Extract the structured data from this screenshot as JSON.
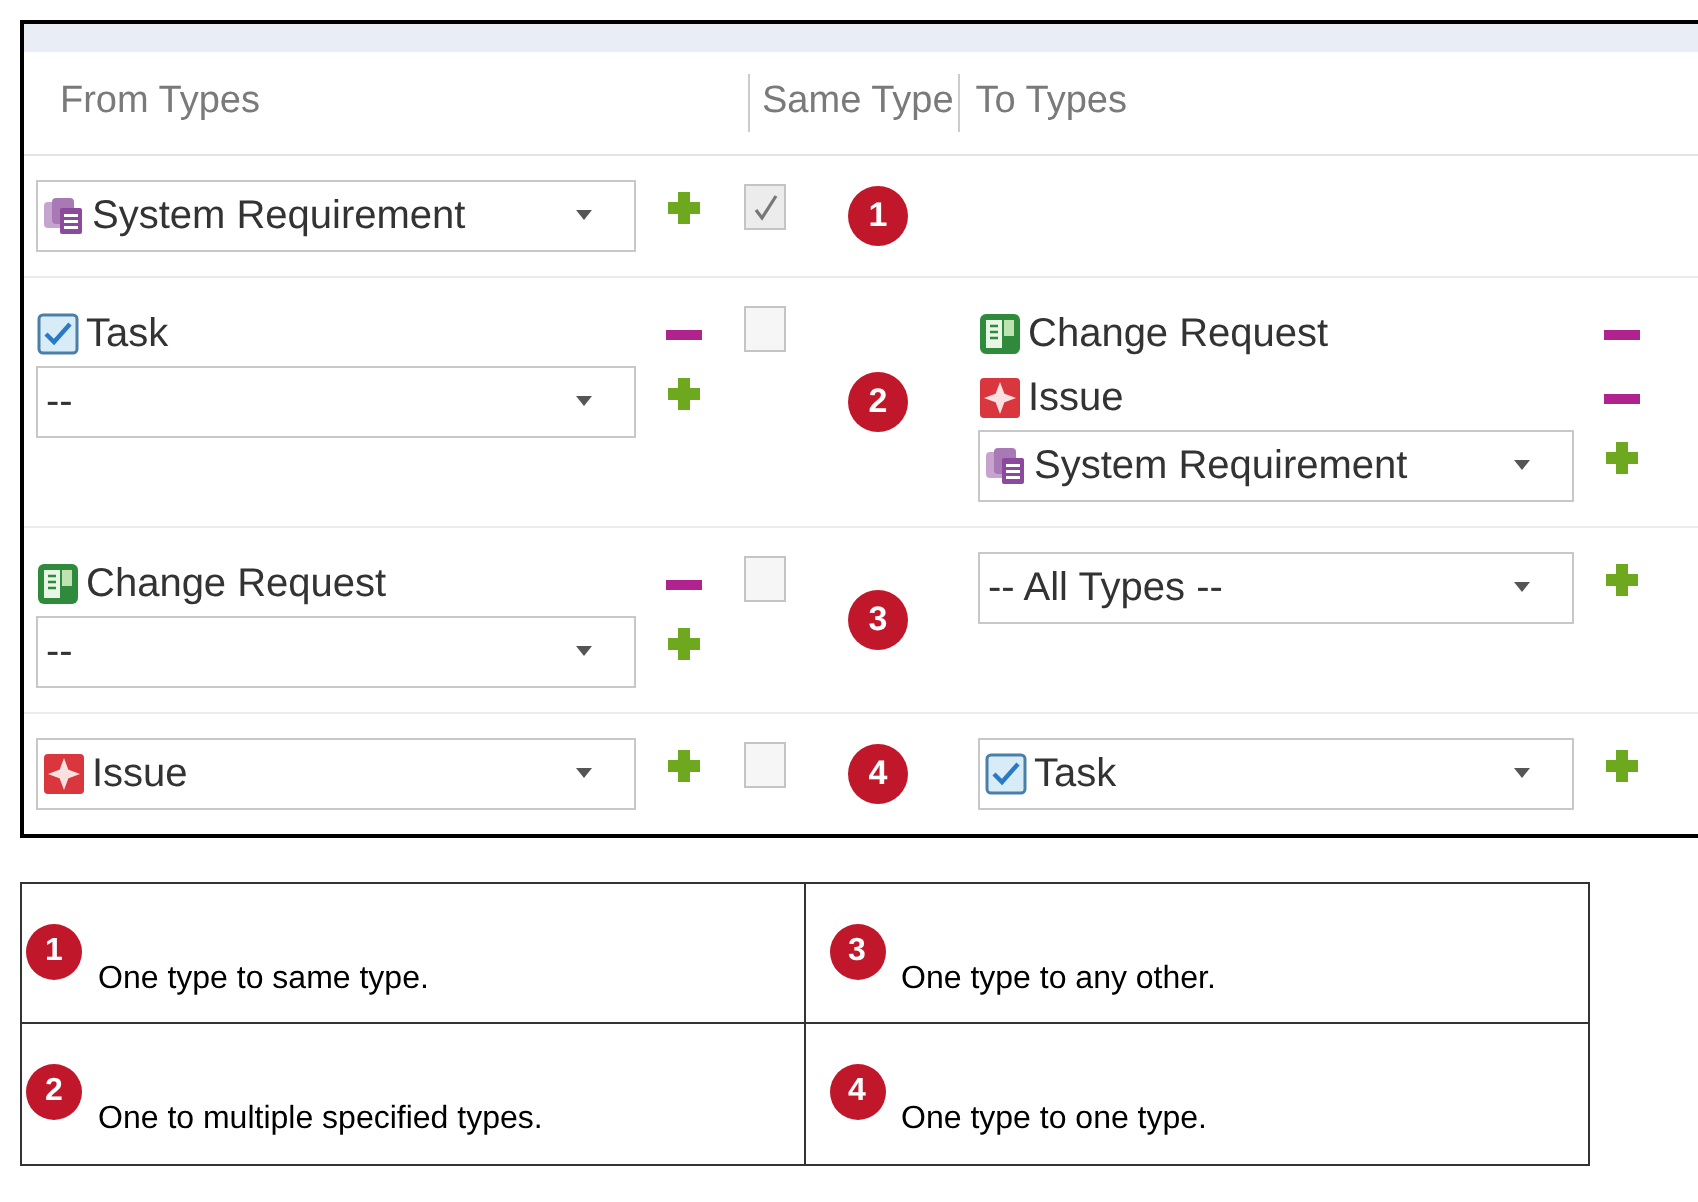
{
  "header": {
    "columns": [
      "From Types",
      "Same Type",
      "To Types"
    ]
  },
  "rows": [
    {
      "from_items": [],
      "from_select": {
        "value": "System Requirement",
        "kind": "requirement"
      },
      "same_type": true,
      "badge": "1",
      "to_items": [],
      "to_select": null
    },
    {
      "from_items": [
        {
          "label": "Task",
          "kind": "task"
        }
      ],
      "from_select": {
        "value": "--",
        "kind": "none"
      },
      "same_type": false,
      "badge": "2",
      "to_items": [
        {
          "label": "Change Request",
          "kind": "change"
        },
        {
          "label": "Issue",
          "kind": "issue"
        }
      ],
      "to_select": {
        "value": "System Requirement",
        "kind": "requirement"
      }
    },
    {
      "from_items": [
        {
          "label": "Change Request",
          "kind": "change"
        }
      ],
      "from_select": {
        "value": "--",
        "kind": "none"
      },
      "same_type": false,
      "badge": "3",
      "to_items": [],
      "to_select": {
        "value": "-- All Types --",
        "kind": "none"
      }
    },
    {
      "from_items": [],
      "from_select": {
        "value": "Issue",
        "kind": "issue"
      },
      "same_type": false,
      "badge": "4",
      "to_items": [],
      "to_select": {
        "value": "Task",
        "kind": "task"
      }
    }
  ],
  "legend": [
    {
      "badge": "1",
      "text": "One type to same type."
    },
    {
      "badge": "3",
      "text": "One type to any other."
    },
    {
      "badge": "2",
      "text": "One to multiple specified types."
    },
    {
      "badge": "4",
      "text": "One type to one type."
    }
  ]
}
